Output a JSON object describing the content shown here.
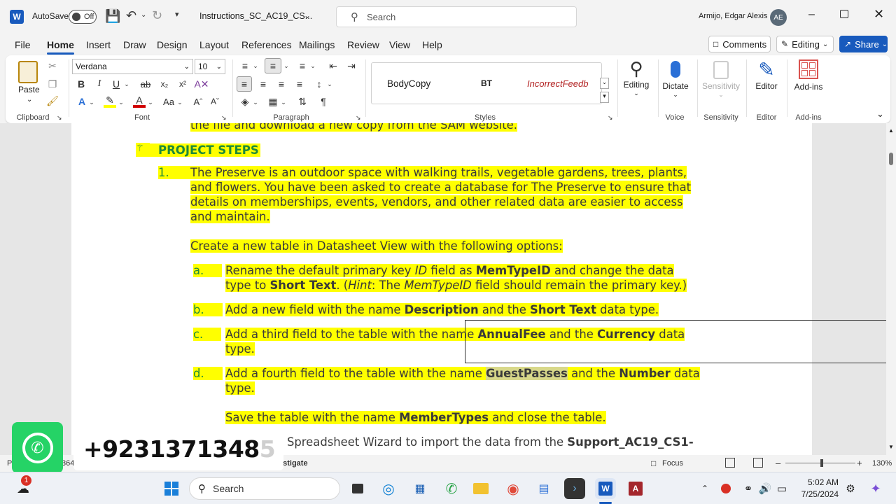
{
  "titlebar": {
    "autosave_label": "AutoSave",
    "autosave_state": "Off",
    "doc_title": "Instructions_SC_AC19_CS...",
    "search_placeholder": "Search",
    "user_name": "Armijo, Edgar Alexis",
    "user_initials": "AE"
  },
  "menu": {
    "items": [
      "File",
      "Home",
      "Insert",
      "Draw",
      "Design",
      "Layout",
      "References",
      "Mailings",
      "Review",
      "View",
      "Help"
    ],
    "active": "Home",
    "comments_label": "Comments",
    "editing_label": "Editing",
    "share_label": "Share"
  },
  "ribbon": {
    "paste_label": "Paste",
    "font_name": "Verdana",
    "font_size": "10",
    "styles": [
      "BodyCopy",
      "BT",
      "IncorrectFeedb"
    ],
    "editing_label": "Editing",
    "dictate_label": "Dictate",
    "sensitivity_label": "Sensitivity",
    "editor_label": "Editor",
    "addins_label": "Add-ins",
    "groups": {
      "clipboard": "Clipboard",
      "font": "Font",
      "paragraph": "Paragraph",
      "styles": "Styles",
      "voice": "Voice",
      "sensitivity": "Sensitivity",
      "editor": "Editor",
      "addins": "Add-ins"
    }
  },
  "document": {
    "top_cut": "the file and download a new copy from the SAM website.",
    "heading": "PROJECT STEPS",
    "step1_num": "1.",
    "step1_lines": [
      "The Preserve is an outdoor space with walking trails, vegetable gardens, trees, plants,",
      "and flowers. You have been asked to create a database for The Preserve to ensure that",
      "details on memberships, events, vendors, and other related data are easier to access",
      "and maintain."
    ],
    "create_line": "Create a new table in Datasheet View with the following options:",
    "a_letter": "a.",
    "a_l1_pre": "Rename the default primary key ",
    "a_l1_it": "ID",
    "a_l1_mid": " field as ",
    "a_l1_b": "MemTypeID",
    "a_l1_post": " and change the data",
    "a_l2_pre": "type to ",
    "a_l2_b": "Short Text",
    "a_l2_mid": ". (",
    "a_l2_it1": "Hint",
    "a_l2_mid2": ": The ",
    "a_l2_it2": "MemTypeID",
    "a_l2_post": " field should remain the primary key.)",
    "b_letter": "b.",
    "b_pre": "Add a new field with the name ",
    "b_b1": "Description",
    "b_mid": " and the ",
    "b_b2": "Short Text",
    "b_post": " data type.",
    "c_letter": "c.",
    "c_pre": "Add a third field to the table with the name ",
    "c_b1": "AnnualFee",
    "c_mid": " and the ",
    "c_b2": "Currency",
    "c_post": " data",
    "c_l2": "type.",
    "d_letter": "d.",
    "d_pre": "Add a fourth field to the table with the name ",
    "d_b1": "GuestPasses",
    "d_mid": " and the ",
    "d_b2": "Number",
    "d_post": " data",
    "d_l2": "type.",
    "save_pre": "Save the table with the name ",
    "save_b": "MemberTypes",
    "save_post": " and close the table.",
    "next_pre": "Spreadsheet Wizard to import the data from the ",
    "next_b": "Support_AC19_CS1-"
  },
  "overlay": {
    "phone": "+9231371348",
    "phone_faded": "5"
  },
  "statusbar": {
    "left": "P",
    "words": "364 w",
    "investigate": "estigate",
    "focus": "Focus",
    "zoom": "130%"
  },
  "taskbar": {
    "search": "Search",
    "time": "5:02 AM",
    "date": "7/25/2024",
    "badge": "1"
  }
}
